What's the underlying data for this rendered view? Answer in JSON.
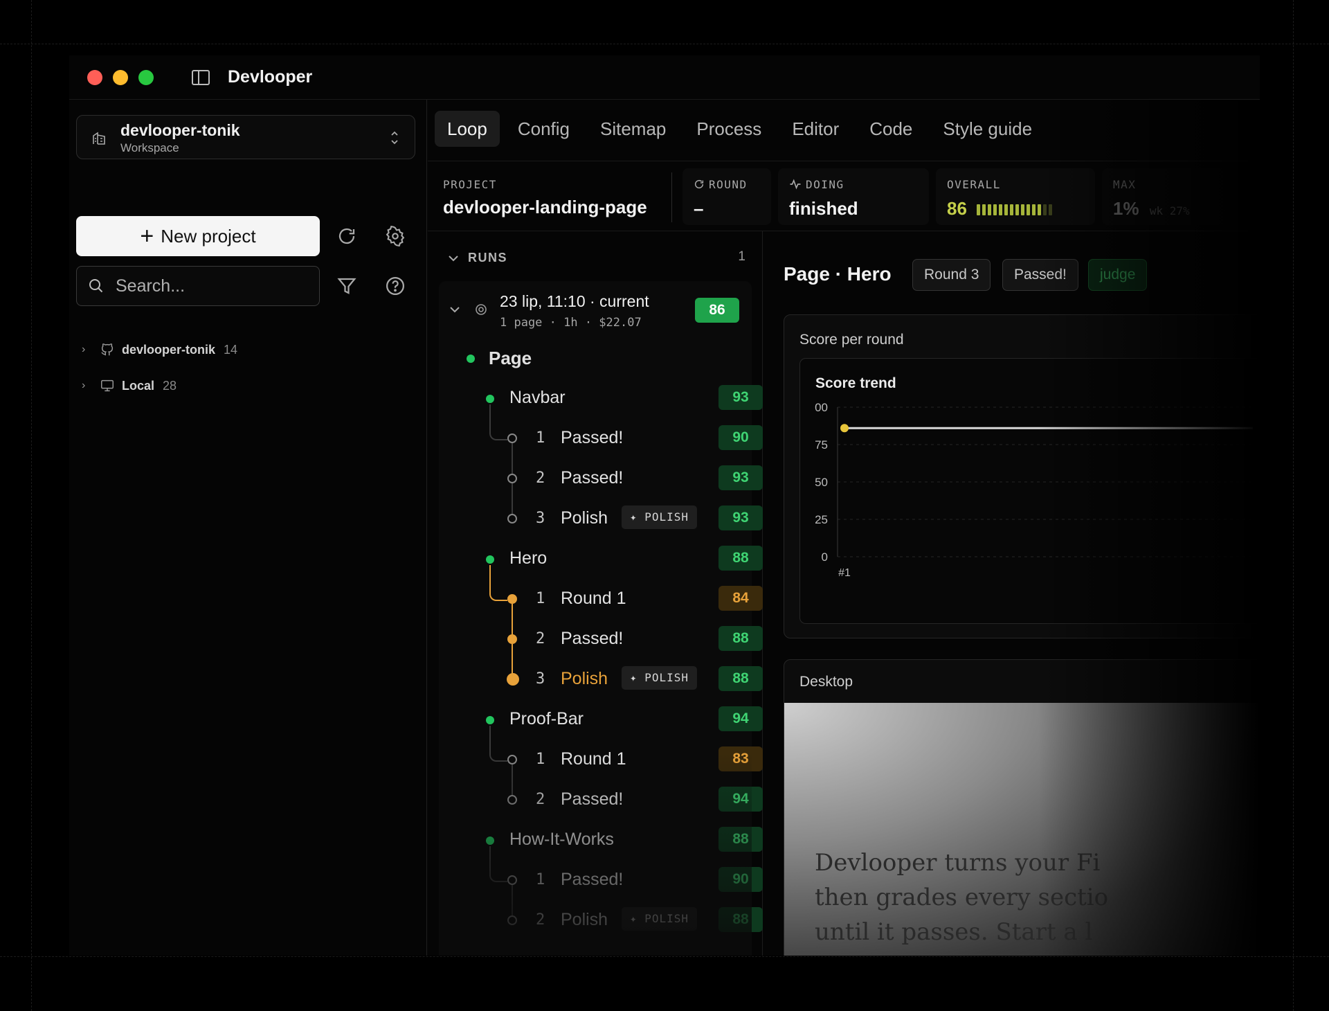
{
  "window": {
    "title": "Devlooper",
    "colors": {
      "close": "#ff5f57",
      "minimize": "#febc2e",
      "maximize": "#28c840"
    }
  },
  "sidebar": {
    "workspace": {
      "name": "devlooper-tonik",
      "sub": "Workspace"
    },
    "new_project_label": "New project",
    "search_placeholder": "Search...",
    "tree": [
      {
        "name": "devlooper-tonik",
        "count": "14",
        "icon": "github-icon"
      },
      {
        "name": "Local",
        "count": "28",
        "icon": "monitor-icon"
      }
    ]
  },
  "tabs": [
    "Loop",
    "Config",
    "Sitemap",
    "Process",
    "Editor",
    "Code",
    "Style guide"
  ],
  "active_tab": "Loop",
  "stats": {
    "project_label": "PROJECT",
    "project_value": "devlooper-landing-page",
    "round_label": "ROUND",
    "round_value": "–",
    "doing_label": "DOING",
    "doing_value": "finished",
    "overall_label": "OVERALL",
    "overall_value": "86",
    "overall_fraction": 0.86,
    "max_label": "MAX",
    "max_value": "1%",
    "max_sub": "wk 27%"
  },
  "runs": {
    "header": "RUNS",
    "count": "1",
    "run": {
      "date": "23 lip, 11:10 · current",
      "meta": "1 page · 1h · $22.07",
      "score": "86",
      "page_label": "Page",
      "sections": [
        {
          "name": "Navbar",
          "score": "93",
          "rounds": [
            {
              "num": "1",
              "label": "Passed!",
              "score": "90",
              "polish": false,
              "tone": "green"
            },
            {
              "num": "2",
              "label": "Passed!",
              "score": "93",
              "polish": false,
              "tone": "green"
            },
            {
              "num": "3",
              "label": "Polish",
              "score": "93",
              "polish": true,
              "tone": "green"
            }
          ]
        },
        {
          "name": "Hero",
          "score": "88",
          "active": true,
          "rounds": [
            {
              "num": "1",
              "label": "Round 1",
              "score": "84",
              "polish": false,
              "tone": "amber"
            },
            {
              "num": "2",
              "label": "Passed!",
              "score": "88",
              "polish": false,
              "tone": "green"
            },
            {
              "num": "3",
              "label": "Polish",
              "score": "88",
              "polish": true,
              "tone": "green"
            }
          ]
        },
        {
          "name": "Proof-Bar",
          "score": "94",
          "rounds": [
            {
              "num": "1",
              "label": "Round 1",
              "score": "83",
              "polish": false,
              "tone": "amber"
            },
            {
              "num": "2",
              "label": "Passed!",
              "score": "94",
              "polish": false,
              "tone": "green"
            }
          ]
        },
        {
          "name": "How-It-Works",
          "score": "88",
          "rounds": [
            {
              "num": "1",
              "label": "Passed!",
              "score": "90",
              "polish": false,
              "tone": "green"
            },
            {
              "num": "2",
              "label": "Polish",
              "score": "88",
              "polish": true,
              "tone": "green"
            }
          ]
        }
      ],
      "polish_tag": "✦ POLISH"
    }
  },
  "detail": {
    "title": "Page · Hero",
    "chips": [
      "Round 3",
      "Passed!",
      "judge"
    ],
    "score_panel_title": "Score per round",
    "desktop_panel_title": "Desktop",
    "hero_text": [
      "Devlooper turns your Fi",
      "then grades every sectio",
      "until it passes. Start a l"
    ]
  },
  "chart_data": {
    "type": "line",
    "title": "Score trend",
    "x": [
      "#1"
    ],
    "yticks": [
      "00",
      "75",
      "50",
      "25",
      "0"
    ],
    "ylim": [
      0,
      100
    ],
    "series": [
      {
        "values": [
          86
        ],
        "color": "#e8c53a"
      }
    ],
    "grid": true
  }
}
